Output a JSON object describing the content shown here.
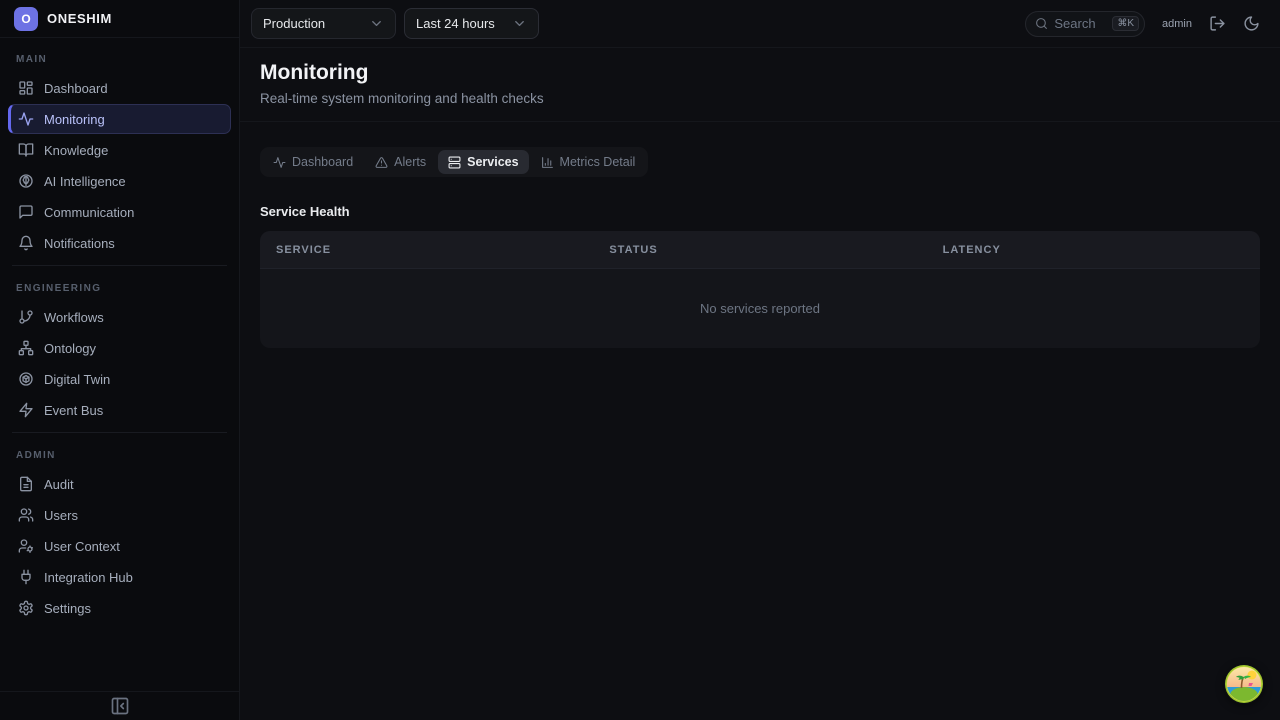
{
  "app": {
    "name": "ONESHIM",
    "logo_letter": "O"
  },
  "colors": {
    "accent": "#6366f1",
    "active_item_text": "#b9c1f9",
    "background": "#0b0c10",
    "surface": "#14151a",
    "active_tab_bg": "#282a31"
  },
  "sidebar": {
    "sections": [
      {
        "label": "MAIN",
        "items": [
          {
            "label": "Dashboard"
          },
          {
            "label": "Monitoring",
            "active": true
          },
          {
            "label": "Knowledge"
          },
          {
            "label": "AI Intelligence"
          },
          {
            "label": "Communication"
          },
          {
            "label": "Notifications"
          }
        ]
      },
      {
        "label": "ENGINEERING",
        "items": [
          {
            "label": "Workflows"
          },
          {
            "label": "Ontology"
          },
          {
            "label": "Digital Twin"
          },
          {
            "label": "Event Bus"
          }
        ]
      },
      {
        "label": "ADMIN",
        "items": [
          {
            "label": "Audit"
          },
          {
            "label": "Users"
          },
          {
            "label": "User Context"
          },
          {
            "label": "Integration Hub"
          },
          {
            "label": "Settings"
          }
        ]
      }
    ]
  },
  "topbar": {
    "environment": {
      "value": "Production"
    },
    "time_range": {
      "value": "Last 24 hours"
    },
    "search": {
      "placeholder": "Search",
      "shortcut": "⌘K"
    },
    "username": "admin"
  },
  "page": {
    "title": "Monitoring",
    "subtitle": "Real-time system monitoring and health checks"
  },
  "tabs": [
    {
      "label": "Dashboard"
    },
    {
      "label": "Alerts"
    },
    {
      "label": "Services",
      "active": true
    },
    {
      "label": "Metrics Detail"
    }
  ],
  "service_health": {
    "heading": "Service Health",
    "table": {
      "columns": [
        "SERVICE",
        "STATUS",
        "LATENCY"
      ],
      "rows": [],
      "empty_message": "No services reported"
    }
  }
}
